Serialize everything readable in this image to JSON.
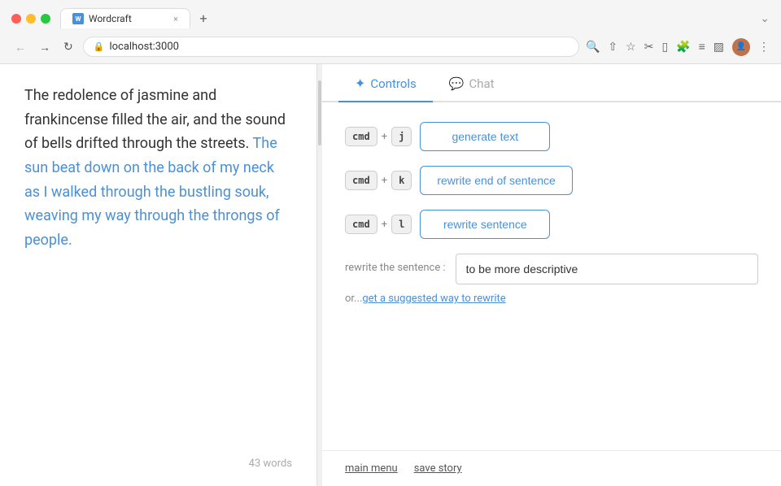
{
  "browser": {
    "tab_title": "Wordcraft",
    "tab_favicon_label": "W",
    "tab_close": "×",
    "new_tab": "+",
    "address": "localhost:3000",
    "more_options": "⋮"
  },
  "editor": {
    "text_normal_1": "The redolence of jasmine and frankincense filled the air, and the sound of bells drifted through the streets. ",
    "text_highlighted": "The sun beat down on the back of my neck as I walked through the bustling souk, weaving my way through the throngs of people.",
    "word_count": "43 words"
  },
  "controls": {
    "tab_controls": "Controls",
    "tab_chat": "Chat",
    "commands": [
      {
        "modifier": "cmd",
        "plus": "+",
        "key": "j",
        "label": "generate text"
      },
      {
        "modifier": "cmd",
        "plus": "+",
        "key": "k",
        "label": "rewrite end of sentence"
      },
      {
        "modifier": "cmd",
        "plus": "+",
        "key": "l",
        "label": "rewrite sentence"
      }
    ],
    "rewrite_label": "rewrite the sentence :",
    "rewrite_placeholder": "to be more descriptive",
    "rewrite_input_value": "to be more descriptive",
    "suggested_prefix": "or...",
    "suggested_link": "get a suggested way to rewrite"
  },
  "footer": {
    "main_menu": "main menu",
    "save_story": "save story"
  }
}
